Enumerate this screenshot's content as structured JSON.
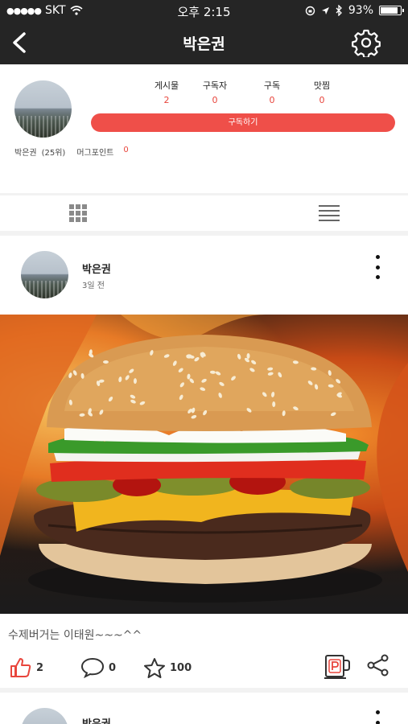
{
  "status_bar": {
    "carrier": "SKT",
    "time": "오후 2:15",
    "battery": "93%",
    "battery_level": 0.93
  },
  "nav": {
    "title": "박은권"
  },
  "profile": {
    "stats": [
      {
        "label": "게시물",
        "value": "2"
      },
      {
        "label": "구독자",
        "value": "0"
      },
      {
        "label": "구독",
        "value": "0"
      },
      {
        "label": "맛찜",
        "value": "0"
      }
    ],
    "subscribe_label": "구독하기",
    "name": "박은권",
    "rank": "(25위)",
    "mug_point_label": "머그포인트",
    "mug_point_value": "0"
  },
  "posts": [
    {
      "author": "박은권",
      "time": "3일 전",
      "caption": "수제버거는 이태원~~~^^",
      "likes": "2",
      "comments": "0",
      "stars": "100"
    },
    {
      "author": "박은권"
    }
  ],
  "colors": {
    "accent": "#ef4f49",
    "bar": "#252525"
  }
}
